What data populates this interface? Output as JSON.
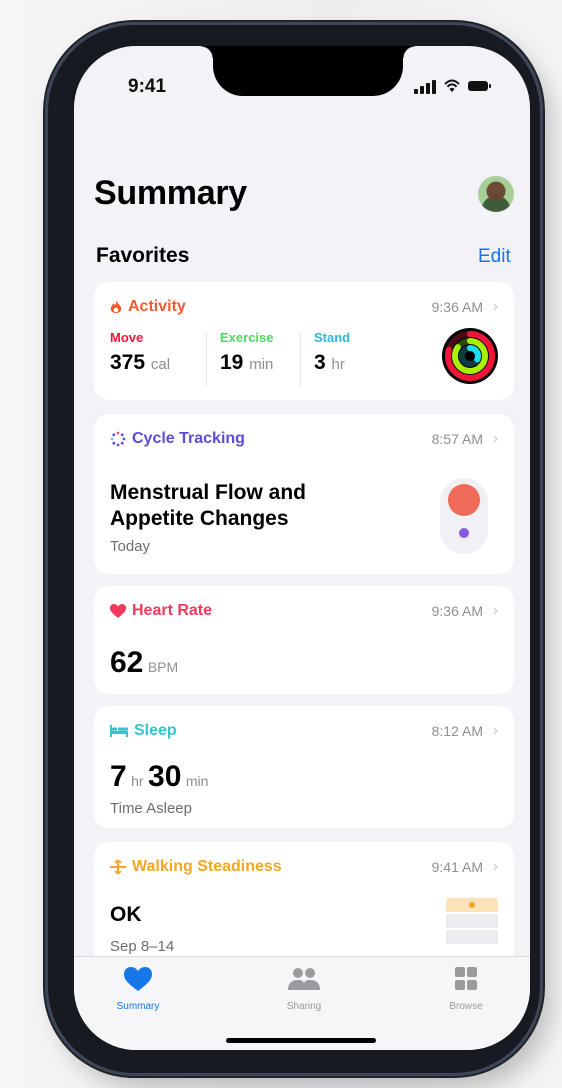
{
  "status_bar": {
    "time": "9:41"
  },
  "page_title": "Summary",
  "favorites": {
    "title": "Favorites",
    "edit_label": "Edit"
  },
  "cards": {
    "activity": {
      "title": "Activity",
      "time": "9:36 AM",
      "color": "#f25a2c",
      "move": {
        "label": "Move",
        "value": "375",
        "unit": "cal",
        "color": "#f0163a"
      },
      "exercise": {
        "label": "Exercise",
        "value": "19",
        "unit": "min",
        "color": "#4cd964"
      },
      "stand": {
        "label": "Stand",
        "value": "3",
        "unit": "hr",
        "color": "#2fb6d9"
      }
    },
    "cycle": {
      "title": "Cycle Tracking",
      "time": "8:57 AM",
      "color": "#5e4bd8",
      "headline_line1": "Menstrual Flow and",
      "headline_line2": "Appetite Changes",
      "subtitle": "Today"
    },
    "heart": {
      "title": "Heart Rate",
      "time": "9:36 AM",
      "color": "#f23a5c",
      "value": "62",
      "unit": "BPM"
    },
    "sleep": {
      "title": "Sleep",
      "time": "8:12 AM",
      "color": "#36c3cf",
      "hours": "7",
      "hours_unit": "hr",
      "minutes": "30",
      "minutes_unit": "min",
      "subtitle": "Time Asleep"
    },
    "walking": {
      "title": "Walking Steadiness",
      "time": "9:41 AM",
      "color": "#f5a623",
      "value": "OK",
      "subtitle": "Sep 8–14"
    }
  },
  "tab_bar": {
    "summary": {
      "label": "Summary",
      "color": "#1677e8"
    },
    "sharing": {
      "label": "Sharing"
    },
    "browse": {
      "label": "Browse"
    }
  },
  "icons": {
    "activity": "flame-icon",
    "cycle": "cycle-dots-icon",
    "heart": "heart-icon",
    "sleep": "bed-icon",
    "walking": "walking-steadiness-icon",
    "chevron": "chevron-right-icon"
  }
}
